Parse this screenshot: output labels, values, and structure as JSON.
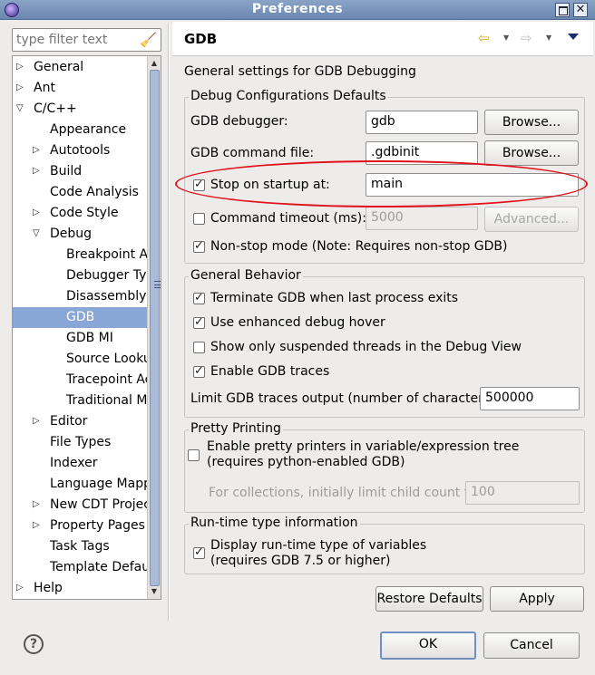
{
  "window": {
    "title": "Preferences",
    "close_glyph": "✕"
  },
  "filter": {
    "placeholder": "type filter text",
    "icon": "clear-filter-icon"
  },
  "tree": {
    "items": [
      {
        "label": "General",
        "arrow": "▷"
      },
      {
        "label": "Ant",
        "arrow": "▷"
      },
      {
        "label": "C/C++",
        "arrow": "▽"
      },
      {
        "label": "Appearance",
        "arrow": ""
      },
      {
        "label": "Autotools",
        "arrow": "▷"
      },
      {
        "label": "Build",
        "arrow": "▷"
      },
      {
        "label": "Code Analysis",
        "arrow": ""
      },
      {
        "label": "Code Style",
        "arrow": "▷"
      },
      {
        "label": "Debug",
        "arrow": "▽"
      },
      {
        "label": "Breakpoint Ac",
        "arrow": ""
      },
      {
        "label": "Debugger Typ",
        "arrow": ""
      },
      {
        "label": "Disassembly",
        "arrow": ""
      },
      {
        "label": "GDB",
        "arrow": ""
      },
      {
        "label": "GDB MI",
        "arrow": ""
      },
      {
        "label": "Source Looku",
        "arrow": ""
      },
      {
        "label": "Tracepoint Ac",
        "arrow": ""
      },
      {
        "label": "Traditional Me",
        "arrow": ""
      },
      {
        "label": "Editor",
        "arrow": "▷"
      },
      {
        "label": "File Types",
        "arrow": ""
      },
      {
        "label": "Indexer",
        "arrow": ""
      },
      {
        "label": "Language Mappi",
        "arrow": ""
      },
      {
        "label": "New CDT Project",
        "arrow": "▷"
      },
      {
        "label": "Property Pages S",
        "arrow": "▷"
      },
      {
        "label": "Task Tags",
        "arrow": ""
      },
      {
        "label": "Template Defaul",
        "arrow": ""
      },
      {
        "label": "Help",
        "arrow": "▷"
      }
    ],
    "selected": "GDB"
  },
  "page": {
    "title": "GDB",
    "description": "General settings for GDB Debugging",
    "debug_defaults": {
      "group_label": "Debug Configurations Defaults",
      "gdb_debugger_label": "GDB debugger:",
      "gdb_debugger_value": "gdb",
      "gdb_command_file_label": "GDB command file:",
      "gdb_command_file_value": ".gdbinit",
      "browse_label": "Browse...",
      "stop_on_startup_label": "Stop on startup at:",
      "stop_on_startup_checked": true,
      "stop_on_startup_value": "main",
      "command_timeout_label": "Command timeout (ms):",
      "command_timeout_checked": false,
      "command_timeout_value": "5000",
      "advanced_label": "Advanced...",
      "non_stop_label": "Non-stop mode (Note: Requires non-stop GDB)",
      "non_stop_checked": true
    },
    "general_behavior": {
      "group_label": "General Behavior",
      "terminate_label": "Terminate GDB when last process exits",
      "terminate_checked": true,
      "hover_label": "Use enhanced debug hover",
      "hover_checked": true,
      "suspended_label": "Show only suspended threads in the Debug View",
      "suspended_checked": false,
      "traces_label": "Enable GDB traces",
      "traces_checked": true,
      "limit_label": "Limit GDB traces output (number of characters):",
      "limit_value": "500000"
    },
    "pretty_printing": {
      "group_label": "Pretty Printing",
      "enable_label_line1": "Enable pretty printers in variable/expression tree",
      "enable_label_line2": "(requires python-enabled GDB)",
      "enable_checked": false,
      "child_count_label": "For collections, initially limit child count to",
      "child_count_value": "100"
    },
    "runtime_type": {
      "group_label": "Run-time type information",
      "display_label_line1": "Display run-time type of variables",
      "display_label_line2": "(requires GDB 7.5 or higher)",
      "display_checked": true
    },
    "restore_defaults_label": "Restore Defaults",
    "apply_label": "Apply"
  },
  "dialog": {
    "ok_label": "OK",
    "cancel_label": "Cancel",
    "help_glyph": "?"
  },
  "colors": {
    "selection": "#88a7d6",
    "annotation_oval": "#e0111a"
  }
}
